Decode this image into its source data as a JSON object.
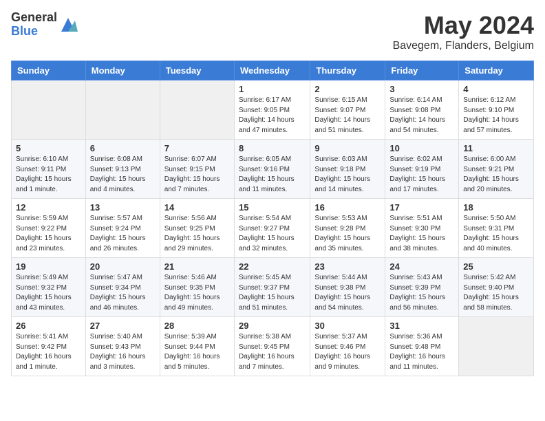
{
  "header": {
    "logo_general": "General",
    "logo_blue": "Blue",
    "month_title": "May 2024",
    "location": "Bavegem, Flanders, Belgium"
  },
  "days_of_week": [
    "Sunday",
    "Monday",
    "Tuesday",
    "Wednesday",
    "Thursday",
    "Friday",
    "Saturday"
  ],
  "weeks": [
    [
      {
        "day": "",
        "info": ""
      },
      {
        "day": "",
        "info": ""
      },
      {
        "day": "",
        "info": ""
      },
      {
        "day": "1",
        "info": "Sunrise: 6:17 AM\nSunset: 9:05 PM\nDaylight: 14 hours\nand 47 minutes."
      },
      {
        "day": "2",
        "info": "Sunrise: 6:15 AM\nSunset: 9:07 PM\nDaylight: 14 hours\nand 51 minutes."
      },
      {
        "day": "3",
        "info": "Sunrise: 6:14 AM\nSunset: 9:08 PM\nDaylight: 14 hours\nand 54 minutes."
      },
      {
        "day": "4",
        "info": "Sunrise: 6:12 AM\nSunset: 9:10 PM\nDaylight: 14 hours\nand 57 minutes."
      }
    ],
    [
      {
        "day": "5",
        "info": "Sunrise: 6:10 AM\nSunset: 9:11 PM\nDaylight: 15 hours\nand 1 minute."
      },
      {
        "day": "6",
        "info": "Sunrise: 6:08 AM\nSunset: 9:13 PM\nDaylight: 15 hours\nand 4 minutes."
      },
      {
        "day": "7",
        "info": "Sunrise: 6:07 AM\nSunset: 9:15 PM\nDaylight: 15 hours\nand 7 minutes."
      },
      {
        "day": "8",
        "info": "Sunrise: 6:05 AM\nSunset: 9:16 PM\nDaylight: 15 hours\nand 11 minutes."
      },
      {
        "day": "9",
        "info": "Sunrise: 6:03 AM\nSunset: 9:18 PM\nDaylight: 15 hours\nand 14 minutes."
      },
      {
        "day": "10",
        "info": "Sunrise: 6:02 AM\nSunset: 9:19 PM\nDaylight: 15 hours\nand 17 minutes."
      },
      {
        "day": "11",
        "info": "Sunrise: 6:00 AM\nSunset: 9:21 PM\nDaylight: 15 hours\nand 20 minutes."
      }
    ],
    [
      {
        "day": "12",
        "info": "Sunrise: 5:59 AM\nSunset: 9:22 PM\nDaylight: 15 hours\nand 23 minutes."
      },
      {
        "day": "13",
        "info": "Sunrise: 5:57 AM\nSunset: 9:24 PM\nDaylight: 15 hours\nand 26 minutes."
      },
      {
        "day": "14",
        "info": "Sunrise: 5:56 AM\nSunset: 9:25 PM\nDaylight: 15 hours\nand 29 minutes."
      },
      {
        "day": "15",
        "info": "Sunrise: 5:54 AM\nSunset: 9:27 PM\nDaylight: 15 hours\nand 32 minutes."
      },
      {
        "day": "16",
        "info": "Sunrise: 5:53 AM\nSunset: 9:28 PM\nDaylight: 15 hours\nand 35 minutes."
      },
      {
        "day": "17",
        "info": "Sunrise: 5:51 AM\nSunset: 9:30 PM\nDaylight: 15 hours\nand 38 minutes."
      },
      {
        "day": "18",
        "info": "Sunrise: 5:50 AM\nSunset: 9:31 PM\nDaylight: 15 hours\nand 40 minutes."
      }
    ],
    [
      {
        "day": "19",
        "info": "Sunrise: 5:49 AM\nSunset: 9:32 PM\nDaylight: 15 hours\nand 43 minutes."
      },
      {
        "day": "20",
        "info": "Sunrise: 5:47 AM\nSunset: 9:34 PM\nDaylight: 15 hours\nand 46 minutes."
      },
      {
        "day": "21",
        "info": "Sunrise: 5:46 AM\nSunset: 9:35 PM\nDaylight: 15 hours\nand 49 minutes."
      },
      {
        "day": "22",
        "info": "Sunrise: 5:45 AM\nSunset: 9:37 PM\nDaylight: 15 hours\nand 51 minutes."
      },
      {
        "day": "23",
        "info": "Sunrise: 5:44 AM\nSunset: 9:38 PM\nDaylight: 15 hours\nand 54 minutes."
      },
      {
        "day": "24",
        "info": "Sunrise: 5:43 AM\nSunset: 9:39 PM\nDaylight: 15 hours\nand 56 minutes."
      },
      {
        "day": "25",
        "info": "Sunrise: 5:42 AM\nSunset: 9:40 PM\nDaylight: 15 hours\nand 58 minutes."
      }
    ],
    [
      {
        "day": "26",
        "info": "Sunrise: 5:41 AM\nSunset: 9:42 PM\nDaylight: 16 hours\nand 1 minute."
      },
      {
        "day": "27",
        "info": "Sunrise: 5:40 AM\nSunset: 9:43 PM\nDaylight: 16 hours\nand 3 minutes."
      },
      {
        "day": "28",
        "info": "Sunrise: 5:39 AM\nSunset: 9:44 PM\nDaylight: 16 hours\nand 5 minutes."
      },
      {
        "day": "29",
        "info": "Sunrise: 5:38 AM\nSunset: 9:45 PM\nDaylight: 16 hours\nand 7 minutes."
      },
      {
        "day": "30",
        "info": "Sunrise: 5:37 AM\nSunset: 9:46 PM\nDaylight: 16 hours\nand 9 minutes."
      },
      {
        "day": "31",
        "info": "Sunrise: 5:36 AM\nSunset: 9:48 PM\nDaylight: 16 hours\nand 11 minutes."
      },
      {
        "day": "",
        "info": ""
      }
    ]
  ]
}
